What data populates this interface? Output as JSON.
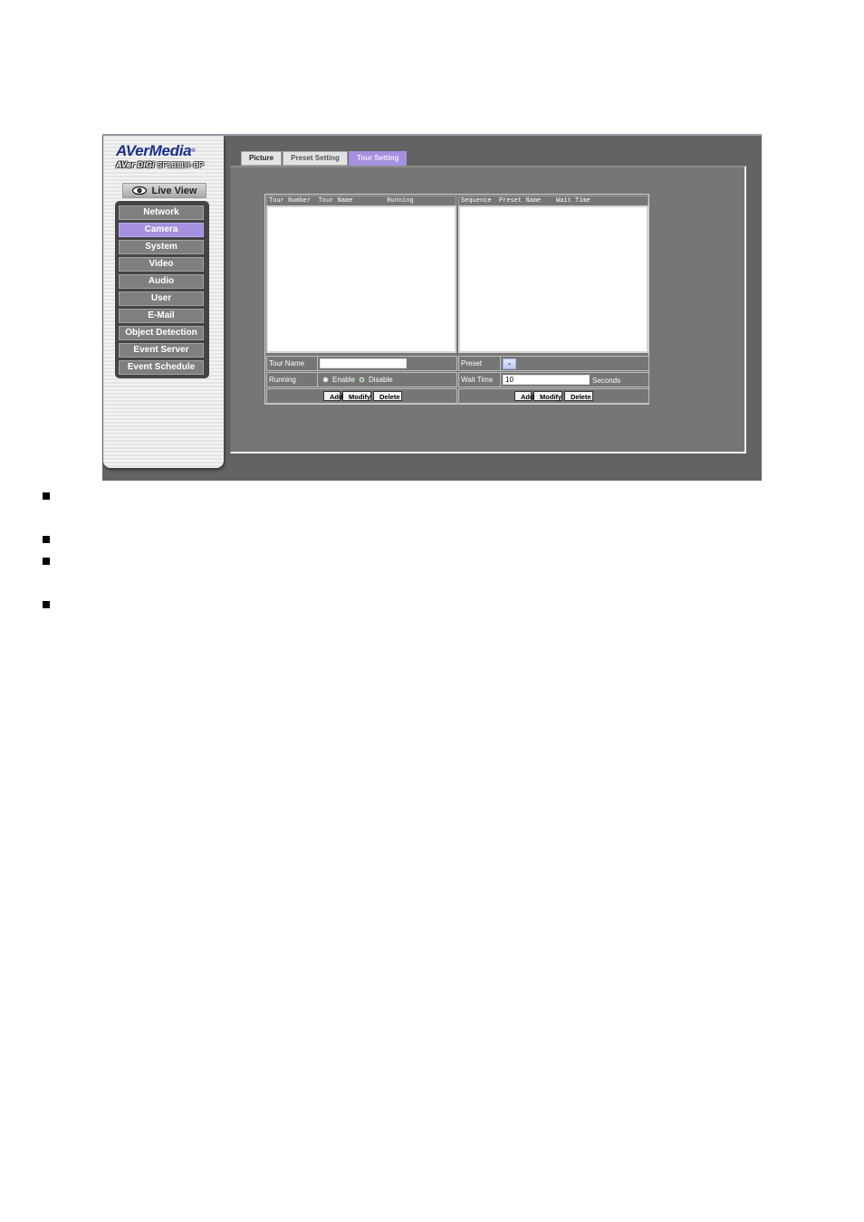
{
  "brand": {
    "logo_main": "AVerMedia",
    "logo_trademark": "®",
    "logo_product": "AVer DiGi",
    "logo_model": "SF1311H-CP"
  },
  "live_view": {
    "icon": "eye-icon",
    "label": "Live View"
  },
  "sidebar": {
    "items": [
      {
        "label": "Network",
        "active": false
      },
      {
        "label": "Camera",
        "active": true
      },
      {
        "label": "System",
        "active": false
      },
      {
        "label": "Video",
        "active": false
      },
      {
        "label": "Audio",
        "active": false
      },
      {
        "label": "User",
        "active": false
      },
      {
        "label": "E-Mail",
        "active": false
      },
      {
        "label": "Object Detection",
        "active": false
      },
      {
        "label": "Event Server",
        "active": false
      },
      {
        "label": "Event Schedule",
        "active": false
      }
    ]
  },
  "tabs": [
    {
      "label": "Picture",
      "active": false
    },
    {
      "label": "Preset Setting",
      "active": false
    },
    {
      "label": "Tour Setting",
      "active": true
    }
  ],
  "tour_panel": {
    "list_header": "Tour Number  Tour Name         Running",
    "list_items": [],
    "tour_name_label": "Tour Name",
    "tour_name_value": "",
    "running_label": "Running",
    "running_options": [
      {
        "label": "Enable",
        "checked": false
      },
      {
        "label": "Disable",
        "checked": true
      }
    ],
    "buttons": {
      "add": "Add",
      "modify": "Modify",
      "delete": "Delete"
    }
  },
  "sequence_panel": {
    "list_header": "Sequence  Preset Name    Wait Time",
    "list_items": [],
    "preset_label": "Preset",
    "preset_value": "",
    "wait_time_label": "Wait Time",
    "wait_time_value": "10",
    "wait_time_unit": "Seconds",
    "buttons": {
      "add": "Add",
      "modify": "Modify",
      "delete": "Delete"
    }
  },
  "colors": {
    "accent_active": "#a691e0",
    "background": "#636363",
    "panel": "#767676",
    "logo_blue": "#1c2f8c"
  },
  "document_bullets": 4
}
